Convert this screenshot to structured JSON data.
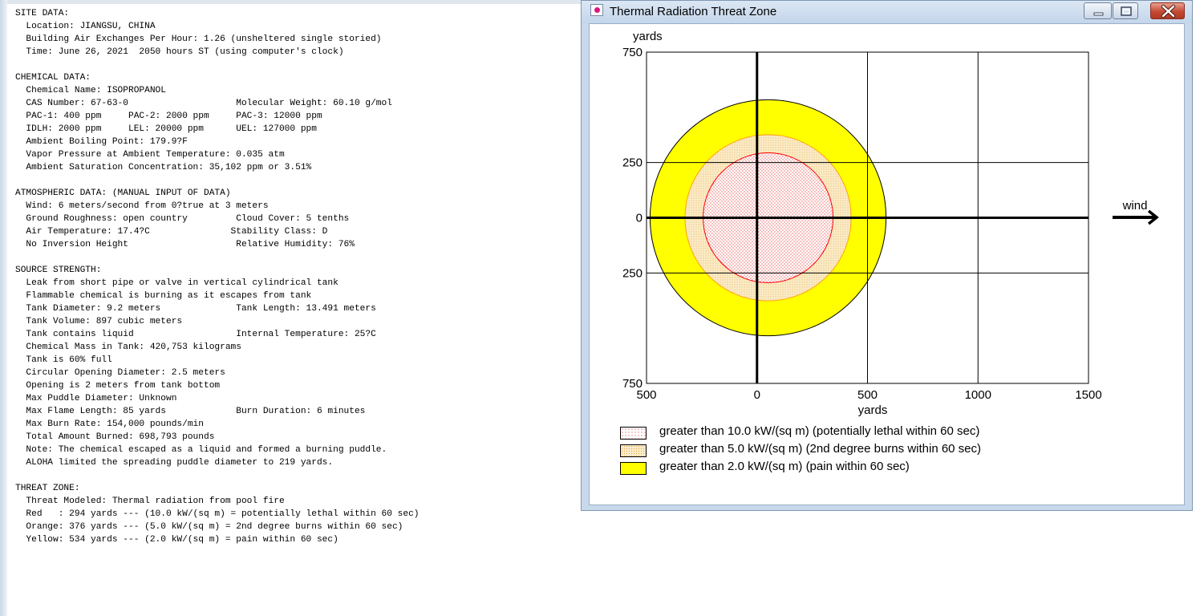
{
  "report": {
    "lines": [
      "SITE DATA:",
      "  Location: JIANGSU, CHINA",
      "  Building Air Exchanges Per Hour: 1.26 (unsheltered single storied)",
      "  Time: June 26, 2021  2050 hours ST (using computer's clock)",
      "",
      "CHEMICAL DATA:",
      "  Chemical Name: ISOPROPANOL",
      "  CAS Number: 67-63-0                    Molecular Weight: 60.10 g/mol",
      "  PAC-1: 400 ppm     PAC-2: 2000 ppm     PAC-3: 12000 ppm",
      "  IDLH: 2000 ppm     LEL: 20000 ppm      UEL: 127000 ppm",
      "  Ambient Boiling Point: 179.9?F",
      "  Vapor Pressure at Ambient Temperature: 0.035 atm",
      "  Ambient Saturation Concentration: 35,102 ppm or 3.51%",
      "",
      "ATMOSPHERIC DATA: (MANUAL INPUT OF DATA)",
      "  Wind: 6 meters/second from 0?true at 3 meters",
      "  Ground Roughness: open country         Cloud Cover: 5 tenths",
      "  Air Temperature: 17.4?C               Stability Class: D",
      "  No Inversion Height                    Relative Humidity: 76%",
      "",
      "SOURCE STRENGTH:",
      "  Leak from short pipe or valve in vertical cylindrical tank",
      "  Flammable chemical is burning as it escapes from tank",
      "  Tank Diameter: 9.2 meters              Tank Length: 13.491 meters",
      "  Tank Volume: 897 cubic meters",
      "  Tank contains liquid                   Internal Temperature: 25?C",
      "  Chemical Mass in Tank: 420,753 kilograms",
      "  Tank is 60% full",
      "  Circular Opening Diameter: 2.5 meters",
      "  Opening is 2 meters from tank bottom",
      "  Max Puddle Diameter: Unknown",
      "  Max Flame Length: 85 yards             Burn Duration: 6 minutes",
      "  Max Burn Rate: 154,000 pounds/min",
      "  Total Amount Burned: 698,793 pounds",
      "  Note: The chemical escaped as a liquid and formed a burning puddle.",
      "  ALOHA limited the spreading puddle diameter to 219 yards.",
      "",
      "THREAT ZONE:",
      "  Threat Modeled: Thermal radiation from pool fire",
      "  Red   : 294 yards --- (10.0 kW/(sq m) = potentially lethal within 60 sec)",
      "  Orange: 376 yards --- (5.0 kW/(sq m) = 2nd degree burns within 60 sec)",
      "  Yellow: 534 yards --- (2.0 kW/(sq m) = pain within 60 sec)"
    ]
  },
  "window": {
    "title": "Thermal Radiation Threat Zone",
    "icon": "app-icon",
    "controls": [
      "minimize-icon",
      "maximize-icon",
      "close-icon"
    ]
  },
  "chart_data": {
    "type": "threat-zone-plot",
    "x_label": "yards",
    "y_label": "yards",
    "x_ticks": [
      "500",
      "0",
      "500",
      "1000",
      "1500"
    ],
    "x_tick_values": [
      -500,
      0,
      500,
      1000,
      1500
    ],
    "y_ticks": [
      "750",
      "250",
      "0",
      "250",
      "750"
    ],
    "y_tick_values": [
      750,
      250,
      0,
      -250,
      -750
    ],
    "xlim": [
      -500,
      1500
    ],
    "ylim": [
      -750,
      750
    ],
    "grid": true,
    "wind_label": "wind",
    "source": [
      0,
      0
    ],
    "zones": [
      {
        "level": "yellow",
        "color": "#ffff00",
        "outline": "#000000",
        "pattern": "solid",
        "center": [
          50,
          0
        ],
        "radius": 534,
        "legend": "greater than 2.0 kW/(sq m) (pain within 60 sec)"
      },
      {
        "level": "orange",
        "color": "#f9e3c3",
        "outline": "#ffa500",
        "pattern": "dots",
        "center": [
          50,
          0
        ],
        "radius": 376,
        "legend": "greater than 5.0 kW/(sq m) (2nd degree burns within 60 sec)"
      },
      {
        "level": "red",
        "color": "#ffffff",
        "outline": "#ff0000",
        "pattern": "dots",
        "center": [
          50,
          0
        ],
        "radius": 294,
        "legend": "greater than 10.0 kW/(sq m) (potentially lethal within 60 sec)"
      }
    ]
  },
  "legend": [
    {
      "label": "greater than 10.0 kW/(sq m) (potentially lethal within 60 sec)",
      "swatch": "red-dots"
    },
    {
      "label": "greater than 5.0 kW/(sq m) (2nd degree burns within 60 sec)",
      "swatch": "orange-dots"
    },
    {
      "label": "greater than 2.0 kW/(sq m) (pain within 60 sec)",
      "swatch": "yellow-solid"
    }
  ]
}
